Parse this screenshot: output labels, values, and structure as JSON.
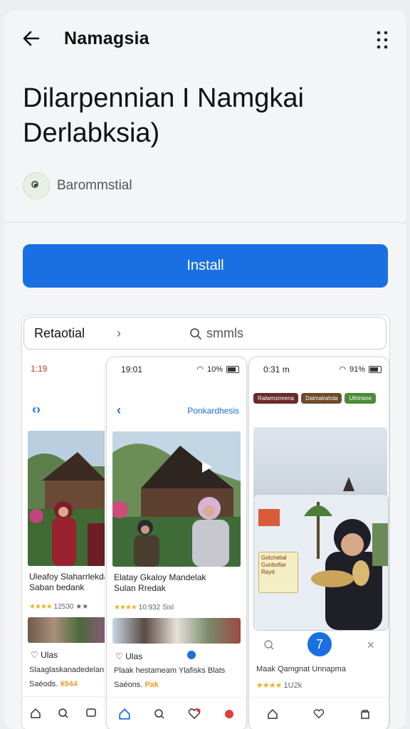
{
  "header": {
    "app_name": "Namagsia",
    "back_icon": "arrow-left-icon",
    "more_icon": "more-vertical-icon"
  },
  "listing": {
    "title_line1": "Dilarpennian I Namgkai",
    "title_line2": "Derlabksia)",
    "developer": "Barommstial",
    "developer_icon": "developer-badge-icon",
    "install_label": "Install",
    "accent_color": "#1a6fe3"
  },
  "screenshots_bar": {
    "label": "Retaotial",
    "search_text": "smmls"
  },
  "phone1": {
    "status_time": "1:19",
    "item_title_line1": "Uleafoy Slaharrlekdap",
    "item_title_line2": "Saban bedank",
    "rating_stars": "★★★★",
    "rating_text": "12530 ★★",
    "heart_text": "Ulas",
    "sub_text": "Slaaglaskanadedelan",
    "price_label": "Saéods.",
    "price_value": "¥944"
  },
  "phone2": {
    "status_time": "19:01",
    "status_battery": "10%",
    "header_link": "Ponkardhesis",
    "item_title_line1": "Elatay Gkaloy Mandelak",
    "item_title_line2": "Sulan Rredak",
    "rating_stars": "★★★★",
    "rating_text": "10:932 Sisl",
    "heart_text": "Ulas",
    "sub_text": "Plaak hestameam  Ylafisks Blats",
    "price_label": "Saéons.",
    "price_value": "Pak"
  },
  "phone3": {
    "status_time": "0:31 m",
    "status_battery": "91%",
    "chips": [
      "Ralwmsmrena",
      "Dalmalrahda",
      "Ultrinsne"
    ],
    "promo_text": "Gotchelial Gunbofiar Rayd",
    "fab_label": "7",
    "sub_text": "Maak Qamgnat Unnapma",
    "rating_stars": "★★★★",
    "rating_text": "1U2k"
  }
}
